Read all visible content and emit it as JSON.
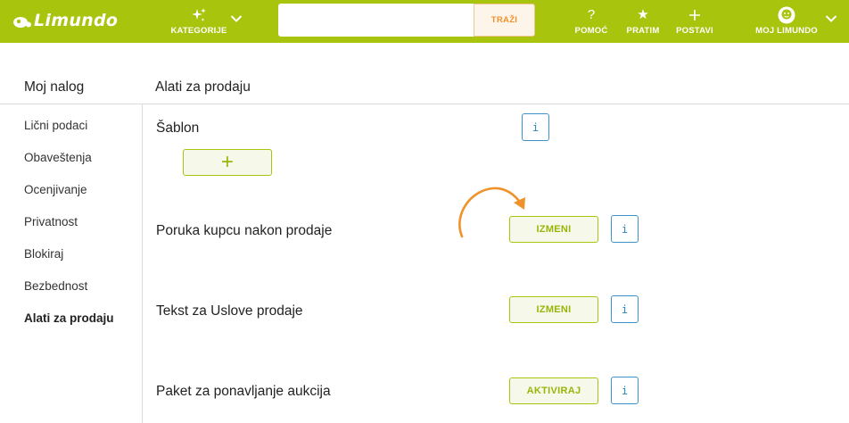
{
  "header": {
    "logo_text": "Limundo",
    "categories_label": "KATEGORIJE",
    "search_placeholder": "",
    "search_button": "TRAŽI",
    "help_label": "POMOĆ",
    "follow_label": "PRATIM",
    "post_label": "POSTAVI",
    "account_label": "MOJ LIMUNDO"
  },
  "sidebar": {
    "title": "Moj nalog",
    "items": [
      {
        "label": "Lični podaci"
      },
      {
        "label": "Obaveštenja"
      },
      {
        "label": "Ocenjivanje"
      },
      {
        "label": "Privatnost"
      },
      {
        "label": "Blokiraj"
      },
      {
        "label": "Bezbednost"
      },
      {
        "label": "Alati za prodaju",
        "active": true
      }
    ]
  },
  "main": {
    "title": "Alati za prodaju",
    "sections": [
      {
        "label": "Šablon",
        "button": "+",
        "info": "i"
      },
      {
        "label": "Poruka kupcu nakon prodaje",
        "button": "IZMENI",
        "info": "i"
      },
      {
        "label": "Tekst za Uslove prodaje",
        "button": "IZMENI",
        "info": "i"
      },
      {
        "label": "Paket za ponavljanje aukcija",
        "button": "AKTIVIRAJ",
        "info": "i"
      }
    ]
  },
  "colors": {
    "brand_green": "#a8c40c",
    "accent_orange": "#f0922b",
    "info_blue": "#3f93c9"
  }
}
